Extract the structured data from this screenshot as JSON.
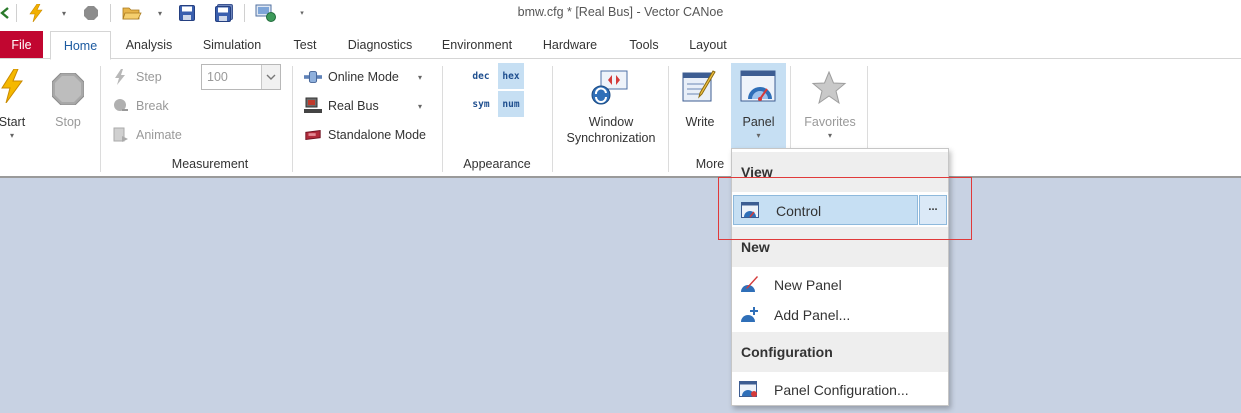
{
  "window": {
    "title": "bmw.cfg * [Real Bus] - Vector CANoe"
  },
  "quick_access": {
    "icons": [
      "back-arrow-icon",
      "lightning-start-icon",
      "stop-icon",
      "open-folder-icon",
      "save-icon",
      "save-all-icon",
      "network-icon"
    ]
  },
  "tabs": [
    {
      "label": "File"
    },
    {
      "label": "Home"
    },
    {
      "label": "Analysis"
    },
    {
      "label": "Simulation"
    },
    {
      "label": "Test"
    },
    {
      "label": "Diagnostics"
    },
    {
      "label": "Environment"
    },
    {
      "label": "Hardware"
    },
    {
      "label": "Tools"
    },
    {
      "label": "Layout"
    }
  ],
  "active_tab": "Home",
  "ribbon": {
    "measurement": {
      "group_label": "Measurement",
      "start_label": "Start",
      "stop_label": "Stop",
      "step_label": "Step",
      "break_label": "Break",
      "animate_label": "Animate",
      "speed_value": "100",
      "online_mode_label": "Online Mode",
      "real_bus_label": "Real Bus",
      "standalone_label": "Standalone Mode"
    },
    "appearance": {
      "group_label": "Appearance",
      "formats": [
        {
          "label": "dec",
          "active": false
        },
        {
          "label": "hex",
          "active": true
        },
        {
          "label": "sym",
          "active": false
        },
        {
          "label": "num",
          "active": true
        }
      ]
    },
    "more": {
      "group_label": "More",
      "window_sync_label_1": "Window",
      "window_sync_label_2": "Synchronization",
      "write_label": "Write",
      "panel_label": "Panel",
      "favorites_label": "Favorites"
    }
  },
  "panel_menu": {
    "view_header": "View",
    "control_label": "Control",
    "control_more": "...",
    "new_header": "New",
    "new_panel_label": "New Panel",
    "add_panel_label": "Add Panel...",
    "config_header": "Configuration",
    "panel_config_label": "Panel Configuration..."
  },
  "colors": {
    "file_tab": "#c10630",
    "active_tab_text": "#1c5aa0",
    "pressed_button": "#c6dff3",
    "workspace": "#c8d2e3",
    "highlight_box": "#e03a3a"
  }
}
